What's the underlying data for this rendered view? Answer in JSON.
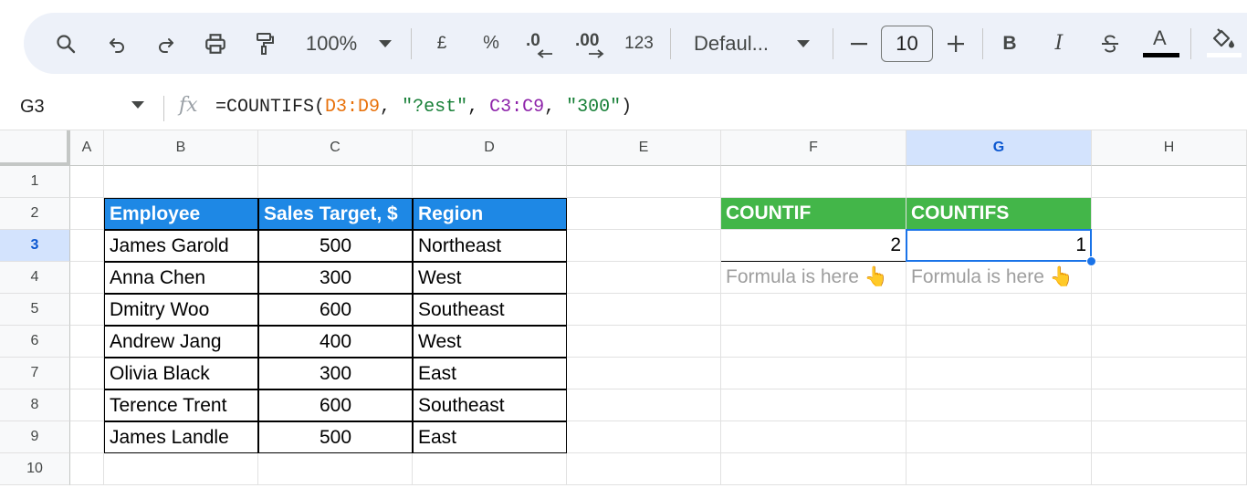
{
  "toolbar": {
    "zoom": "100%",
    "currency": "£",
    "percent": "%",
    "decrease_decimals": ".0",
    "increase_decimals": ".00",
    "number_format": "123",
    "font": "Defaul...",
    "font_size": "10",
    "bold": "B",
    "italic": "I",
    "text_color_letter": "A"
  },
  "formula_bar": {
    "cell_ref": "G3",
    "fx": "fx",
    "formula_parts": [
      {
        "text": "=COUNTIFS(",
        "color": "default"
      },
      {
        "text": "D3:D9",
        "color": "orange"
      },
      {
        "text": ", ",
        "color": "default"
      },
      {
        "text": "\"?est\"",
        "color": "green"
      },
      {
        "text": ", ",
        "color": "default"
      },
      {
        "text": "C3:C9",
        "color": "purple"
      },
      {
        "text": ", ",
        "color": "default"
      },
      {
        "text": "\"300\"",
        "color": "green"
      },
      {
        "text": ")",
        "color": "default"
      }
    ]
  },
  "columns": [
    "A",
    "B",
    "C",
    "D",
    "E",
    "F",
    "G",
    "H"
  ],
  "selected_column": "G",
  "rows": [
    "1",
    "2",
    "3",
    "4",
    "5",
    "6",
    "7",
    "8",
    "9",
    "10"
  ],
  "selected_row": "3",
  "table": {
    "headers": [
      "Employee",
      "Sales Target, $",
      "Region"
    ],
    "rows": [
      [
        "James Garold",
        "500",
        "Northeast"
      ],
      [
        "Anna Chen",
        "300",
        "West"
      ],
      [
        "Dmitry Woo",
        "600",
        "Southeast"
      ],
      [
        "Andrew Jang",
        "400",
        "West"
      ],
      [
        "Olivia Black",
        "300",
        "East"
      ],
      [
        "Terence Trent",
        "600",
        "Southeast"
      ],
      [
        "James Landle",
        "500",
        "East"
      ]
    ]
  },
  "results": {
    "countif_header": "COUNTIF",
    "countifs_header": "COUNTIFS",
    "countif_value": "2",
    "countifs_value": "1",
    "note_f": "Formula is here 👆",
    "note_g": "Formula is here 👆"
  },
  "colors": {
    "table_header": "#1e88e5",
    "results_header": "#43b649",
    "selection": "#1a73e8"
  }
}
